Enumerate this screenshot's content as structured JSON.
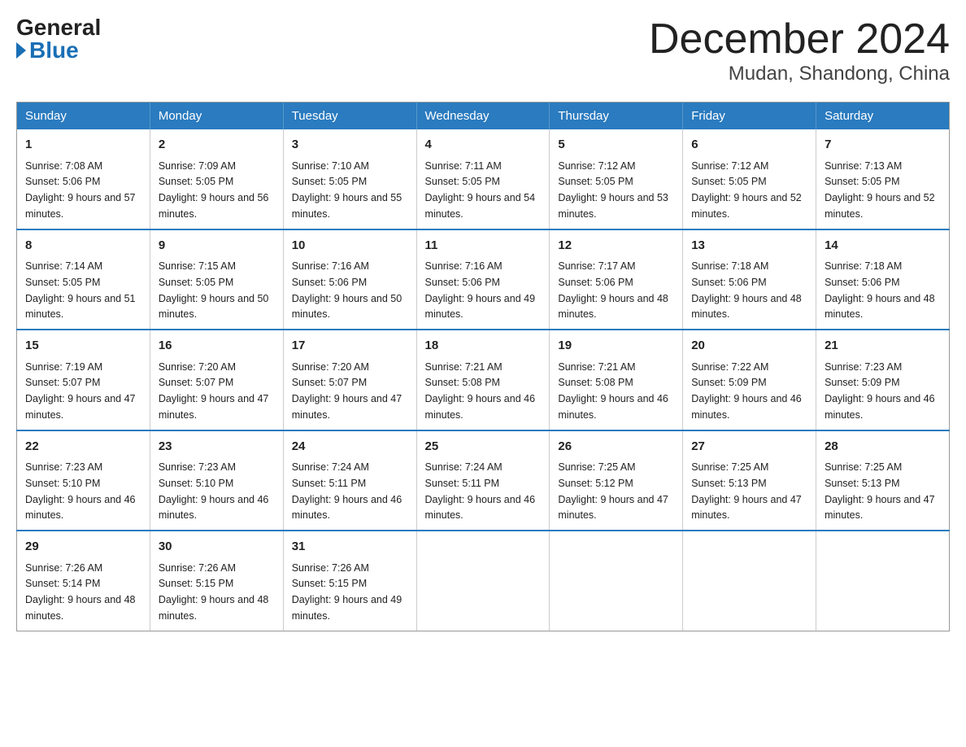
{
  "header": {
    "logo_general": "General",
    "logo_blue": "Blue",
    "month_title": "December 2024",
    "location": "Mudan, Shandong, China"
  },
  "weekdays": [
    "Sunday",
    "Monday",
    "Tuesday",
    "Wednesday",
    "Thursday",
    "Friday",
    "Saturday"
  ],
  "weeks": [
    [
      {
        "day": "1",
        "sunrise": "7:08 AM",
        "sunset": "5:06 PM",
        "daylight": "9 hours and 57 minutes."
      },
      {
        "day": "2",
        "sunrise": "7:09 AM",
        "sunset": "5:05 PM",
        "daylight": "9 hours and 56 minutes."
      },
      {
        "day": "3",
        "sunrise": "7:10 AM",
        "sunset": "5:05 PM",
        "daylight": "9 hours and 55 minutes."
      },
      {
        "day": "4",
        "sunrise": "7:11 AM",
        "sunset": "5:05 PM",
        "daylight": "9 hours and 54 minutes."
      },
      {
        "day": "5",
        "sunrise": "7:12 AM",
        "sunset": "5:05 PM",
        "daylight": "9 hours and 53 minutes."
      },
      {
        "day": "6",
        "sunrise": "7:12 AM",
        "sunset": "5:05 PM",
        "daylight": "9 hours and 52 minutes."
      },
      {
        "day": "7",
        "sunrise": "7:13 AM",
        "sunset": "5:05 PM",
        "daylight": "9 hours and 52 minutes."
      }
    ],
    [
      {
        "day": "8",
        "sunrise": "7:14 AM",
        "sunset": "5:05 PM",
        "daylight": "9 hours and 51 minutes."
      },
      {
        "day": "9",
        "sunrise": "7:15 AM",
        "sunset": "5:05 PM",
        "daylight": "9 hours and 50 minutes."
      },
      {
        "day": "10",
        "sunrise": "7:16 AM",
        "sunset": "5:06 PM",
        "daylight": "9 hours and 50 minutes."
      },
      {
        "day": "11",
        "sunrise": "7:16 AM",
        "sunset": "5:06 PM",
        "daylight": "9 hours and 49 minutes."
      },
      {
        "day": "12",
        "sunrise": "7:17 AM",
        "sunset": "5:06 PM",
        "daylight": "9 hours and 48 minutes."
      },
      {
        "day": "13",
        "sunrise": "7:18 AM",
        "sunset": "5:06 PM",
        "daylight": "9 hours and 48 minutes."
      },
      {
        "day": "14",
        "sunrise": "7:18 AM",
        "sunset": "5:06 PM",
        "daylight": "9 hours and 48 minutes."
      }
    ],
    [
      {
        "day": "15",
        "sunrise": "7:19 AM",
        "sunset": "5:07 PM",
        "daylight": "9 hours and 47 minutes."
      },
      {
        "day": "16",
        "sunrise": "7:20 AM",
        "sunset": "5:07 PM",
        "daylight": "9 hours and 47 minutes."
      },
      {
        "day": "17",
        "sunrise": "7:20 AM",
        "sunset": "5:07 PM",
        "daylight": "9 hours and 47 minutes."
      },
      {
        "day": "18",
        "sunrise": "7:21 AM",
        "sunset": "5:08 PM",
        "daylight": "9 hours and 46 minutes."
      },
      {
        "day": "19",
        "sunrise": "7:21 AM",
        "sunset": "5:08 PM",
        "daylight": "9 hours and 46 minutes."
      },
      {
        "day": "20",
        "sunrise": "7:22 AM",
        "sunset": "5:09 PM",
        "daylight": "9 hours and 46 minutes."
      },
      {
        "day": "21",
        "sunrise": "7:23 AM",
        "sunset": "5:09 PM",
        "daylight": "9 hours and 46 minutes."
      }
    ],
    [
      {
        "day": "22",
        "sunrise": "7:23 AM",
        "sunset": "5:10 PM",
        "daylight": "9 hours and 46 minutes."
      },
      {
        "day": "23",
        "sunrise": "7:23 AM",
        "sunset": "5:10 PM",
        "daylight": "9 hours and 46 minutes."
      },
      {
        "day": "24",
        "sunrise": "7:24 AM",
        "sunset": "5:11 PM",
        "daylight": "9 hours and 46 minutes."
      },
      {
        "day": "25",
        "sunrise": "7:24 AM",
        "sunset": "5:11 PM",
        "daylight": "9 hours and 46 minutes."
      },
      {
        "day": "26",
        "sunrise": "7:25 AM",
        "sunset": "5:12 PM",
        "daylight": "9 hours and 47 minutes."
      },
      {
        "day": "27",
        "sunrise": "7:25 AM",
        "sunset": "5:13 PM",
        "daylight": "9 hours and 47 minutes."
      },
      {
        "day": "28",
        "sunrise": "7:25 AM",
        "sunset": "5:13 PM",
        "daylight": "9 hours and 47 minutes."
      }
    ],
    [
      {
        "day": "29",
        "sunrise": "7:26 AM",
        "sunset": "5:14 PM",
        "daylight": "9 hours and 48 minutes."
      },
      {
        "day": "30",
        "sunrise": "7:26 AM",
        "sunset": "5:15 PM",
        "daylight": "9 hours and 48 minutes."
      },
      {
        "day": "31",
        "sunrise": "7:26 AM",
        "sunset": "5:15 PM",
        "daylight": "9 hours and 49 minutes."
      },
      null,
      null,
      null,
      null
    ]
  ]
}
